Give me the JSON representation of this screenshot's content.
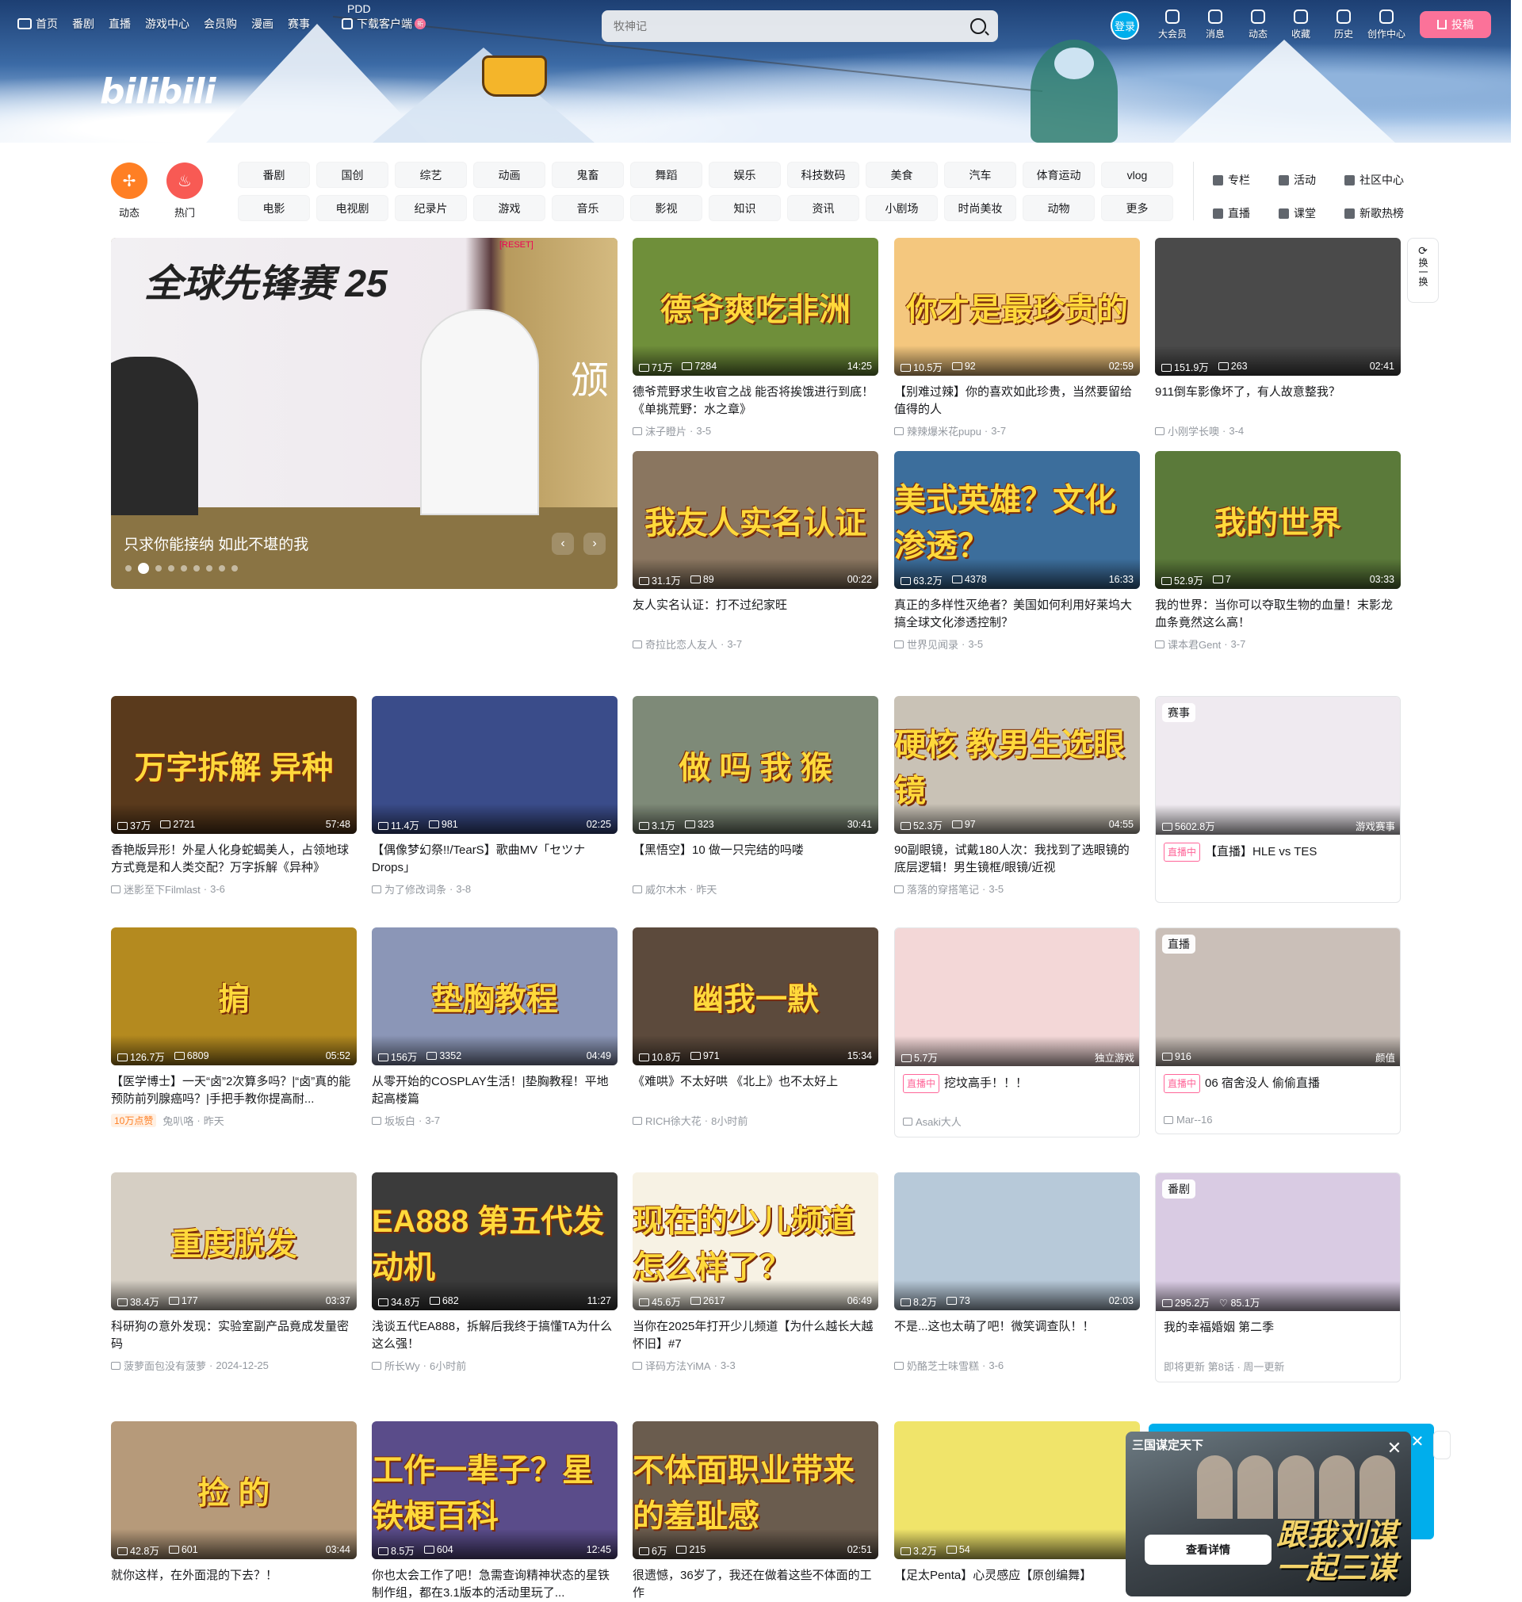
{
  "nav": {
    "items": [
      "首页",
      "番剧",
      "直播",
      "游戏中心",
      "会员购",
      "漫画",
      "赛事"
    ],
    "pdd": "PDD",
    "download": "下载客户端",
    "download_badge": "新"
  },
  "search": {
    "placeholder": "牧神记"
  },
  "user": {
    "login": "登录",
    "icons": [
      {
        "label": "大会员",
        "icon": "vip-icon"
      },
      {
        "label": "消息",
        "icon": "message-icon"
      },
      {
        "label": "动态",
        "icon": "dynamic-icon"
      },
      {
        "label": "收藏",
        "icon": "star-icon"
      },
      {
        "label": "历史",
        "icon": "history-icon"
      },
      {
        "label": "创作中心",
        "icon": "creator-icon"
      }
    ],
    "upload": "投稿"
  },
  "logo": "bilibili",
  "quick": {
    "dynamic": "动态",
    "hot": "热门"
  },
  "channels": [
    "番剧",
    "国创",
    "综艺",
    "动画",
    "鬼畜",
    "舞蹈",
    "娱乐",
    "科技数码",
    "美食",
    "汽车",
    "体育运动",
    "vlog",
    "电影",
    "电视剧",
    "纪录片",
    "游戏",
    "音乐",
    "影视",
    "知识",
    "资讯",
    "小剧场",
    "时尚美妆",
    "动物",
    "更多"
  ],
  "side_links": [
    "专栏",
    "活动",
    "社区中心",
    "直播",
    "课堂",
    "新歌热榜"
  ],
  "hero": {
    "caption": "只求你能接纳 如此不堪的我",
    "img_title": "全球先锋赛 25",
    "reset": "[RESET]",
    "side_char": "颁"
  },
  "refresh": "换一换",
  "cards": [
    {
      "art": "德爷爽吃非洲",
      "views": "71万",
      "danmaku": "7284",
      "dur": "14:25",
      "title": "德爷荒野求生收官之战 能否将挨饿进行到底！《单挑荒野：水之章》",
      "author": "沫子瞪片",
      "date": "3-5",
      "bg": "#6f8f3a"
    },
    {
      "art": "你才是最珍贵的",
      "views": "10.5万",
      "danmaku": "92",
      "dur": "02:59",
      "title": "【别难过辣】你的喜欢如此珍贵，当然要留给值得的人",
      "author": "辣辣爆米花pupu",
      "date": "3-7",
      "bg": "#f4c77e"
    },
    {
      "art": "",
      "views": "151.9万",
      "danmaku": "263",
      "dur": "02:41",
      "title": "911倒车影像坏了，有人故意整我？",
      "author": "小刚学长噢",
      "date": "3-4",
      "bg": "#4a4a4a"
    },
    {
      "art": "我友人实名认证",
      "views": "31.1万",
      "danmaku": "89",
      "dur": "00:22",
      "title": "友人实名认证：打不过纪家旺",
      "author": "奇拉比恋人友人",
      "date": "3-7",
      "bg": "#8a7660"
    },
    {
      "art": "美式英雄？文化渗透？",
      "views": "63.2万",
      "danmaku": "4378",
      "dur": "16:33",
      "title": "真正的多样性灭绝者？美国如何利用好莱坞大搞全球文化渗透控制？",
      "author": "世界见闻录",
      "date": "3-5",
      "bg": "#3c6e9c"
    },
    {
      "art": "我的世界",
      "views": "52.9万",
      "danmaku": "7",
      "dur": "03:33",
      "title": "我的世界：当你可以夺取生物的血量！末影龙血条竟然这么高！",
      "author": "课本君Gent",
      "date": "3-7",
      "bg": "#5b7a3a"
    },
    {
      "art": "万字拆解 异种",
      "views": "37万",
      "danmaku": "2721",
      "dur": "57:48",
      "title": "香艳版异形！外星人化身蛇蝎美人，占领地球方式竟是和人类交配？万字拆解《异种》",
      "author": "迷影至下Filmlast",
      "date": "3-6",
      "bg": "#5a3a1c"
    },
    {
      "art": "",
      "views": "11.4万",
      "danmaku": "981",
      "dur": "02:25",
      "title": "【偶像梦幻祭!!/TearS】歌曲MV「セツナDrops」",
      "author": "为了修改词条",
      "date": "3-8",
      "bg": "#3a4c8a"
    },
    {
      "art": "做 吗 我 猴",
      "views": "3.1万",
      "danmaku": "323",
      "dur": "30:41",
      "title": "【黑悟空】10 做一只完结的吗喽",
      "author": "威尔木木",
      "date": "昨天",
      "bg": "#7e8a78"
    },
    {
      "art": "硬核 教男生选眼镜",
      "views": "52.3万",
      "danmaku": "97",
      "dur": "04:55",
      "title": "90副眼镜，试戴180人次：我找到了选眼镜的底层逻辑！男生镜框/眼镜/近视",
      "author": "落落的穿搭笔记",
      "date": "3-5",
      "bg": "#c9c2b6"
    },
    {
      "art": "",
      "views": "5602.8万",
      "title": "【直播】HLE vs TES",
      "corner": "赛事",
      "category": "游戏赛事",
      "live_tag": "直播中",
      "bg": "#efeaf0"
    },
    {
      "art": "掮",
      "views": "126.7万",
      "danmaku": "6809",
      "dur": "05:52",
      "title": "【医学博士】一天“卤”2次算多吗？|“卤”真的能预防前列腺癌吗？|手把手教你提高耐...",
      "author": "兔叭咯",
      "date": "昨天",
      "hot": "10万点赞",
      "bg": "#b48a1f"
    },
    {
      "art": "垫胸教程",
      "views": "156万",
      "danmaku": "3352",
      "dur": "04:49",
      "title": "从零开始的COSPLAY生活！|垫胸教程！平地起高楼篇",
      "author": "坂坂白",
      "date": "3-7",
      "bg": "#8b96b7"
    },
    {
      "art": "幽我一默",
      "views": "10.8万",
      "danmaku": "971",
      "dur": "15:34",
      "title": "《难哄》不太好哄 《北上》也不太好上",
      "author": "RICH徐大花",
      "date": "8小时前",
      "bg": "#5c4a3c"
    },
    {
      "art": "",
      "views": "5.7万",
      "title": "挖坟高手！！！",
      "category": "独立游戏",
      "live_tag": "直播中",
      "author": "Asaki大人",
      "bg": "#f3d7d7"
    },
    {
      "art": "",
      "views": "916",
      "title": "06 宿舍没人 偷偷直播",
      "corner": "直播",
      "category": "颜值",
      "live_tag": "直播中",
      "author": "Mar--16",
      "bg": "#cabfb8"
    },
    {
      "art": "重度脱发",
      "views": "38.4万",
      "danmaku": "177",
      "dur": "03:37",
      "title": "科研狗の意外发现：实验室副产品竟成发量密码",
      "author": "菠萝面包没有菠萝",
      "date": "2024-12-25",
      "bg": "#d6cfc4"
    },
    {
      "art": "EA888 第五代发动机",
      "views": "34.8万",
      "danmaku": "682",
      "dur": "11:27",
      "title": "浅谈五代EA888，拆解后我终于搞懂TA为什么这么强！",
      "author": "所长Wy",
      "date": "6小时前",
      "bg": "#3b3b3b"
    },
    {
      "art": "现在的少儿频道怎么样了？",
      "views": "45.6万",
      "danmaku": "2617",
      "dur": "06:49",
      "title": "当你在2025年打开少儿频道【为什么越长大越怀旧】#7",
      "author": "译码方法YiMA",
      "date": "3-3",
      "bg": "#f7f2e4"
    },
    {
      "art": "",
      "views": "8.2万",
      "danmaku": "73",
      "dur": "02:03",
      "title": "不是...这也太萌了吧！微笑调查队！！",
      "author": "奶酪芝士味雪糕",
      "date": "3-6",
      "bg": "#b7c9d9"
    },
    {
      "art": "",
      "views": "295.2万",
      "likes": "85.1万",
      "title": "我的幸福婚姻 第二季",
      "corner": "番剧",
      "meta_text": "即将更新 第8话 · 周一更新",
      "bg": "#d9cbe3"
    },
    {
      "art": "捡 的",
      "views": "42.8万",
      "danmaku": "601",
      "dur": "03:44",
      "title": "就你这样，在外面混的下去？！",
      "bg": "#b69a7a"
    },
    {
      "art": "工作一辈子？星铁梗百科",
      "views": "8.5万",
      "danmaku": "604",
      "dur": "12:45",
      "title": "你也太会工作了吧！急需查询精神状态的星铁制作组，都在3.1版本的活动里玩了...",
      "bg": "#5a4c8a"
    },
    {
      "art": "不体面职业带来的羞耻感",
      "views": "6万",
      "danmaku": "215",
      "dur": "02:51",
      "title": "很遗憾，36岁了，我还在做着这些不体面的工作",
      "bg": "#6a5c4e"
    },
    {
      "art": "",
      "views": "3.2万",
      "danmaku": "54",
      "dur": "",
      "title": "【足太Penta】心灵感应【原创编舞】",
      "bg": "#f0e46a"
    }
  ],
  "ad": {
    "title": "三国谋定天下",
    "slogan": "跟我刘谋一起三谋",
    "button": "查看详情",
    "close": "✕"
  },
  "colors": {
    "accent": "#00aeec",
    "pink": "#fb7299",
    "hot": "#ff7f24"
  }
}
